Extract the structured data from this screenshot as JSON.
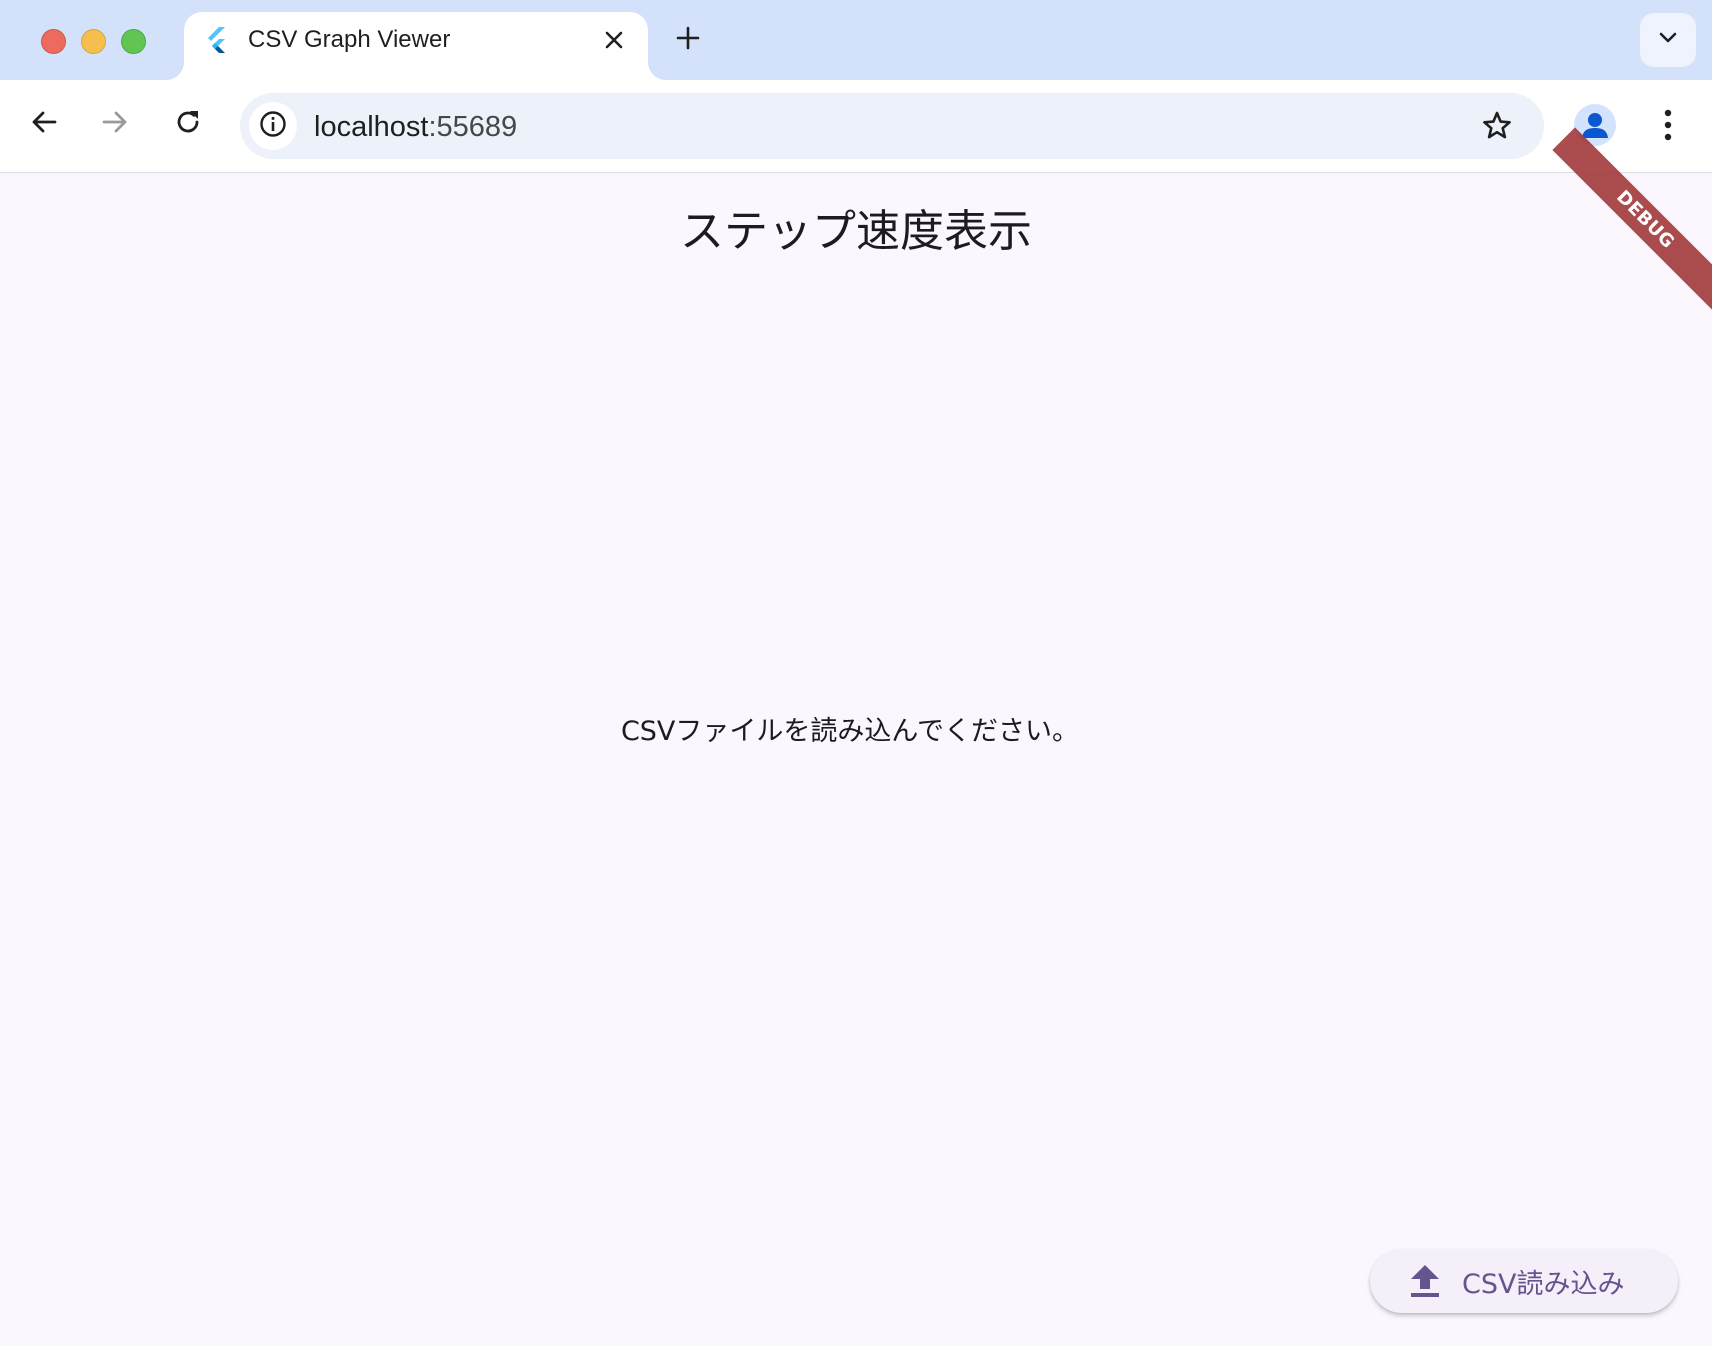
{
  "browser": {
    "tab": {
      "title": "CSV Graph Viewer",
      "favicon": "flutter-logo-icon"
    },
    "toolbar": {
      "url_host": "localhost",
      "url_port": ":55689"
    },
    "icons": {
      "close": "close-icon",
      "new_tab": "plus-icon",
      "tab_search": "chevron-down-icon",
      "back": "arrow-left-icon",
      "forward": "arrow-right-icon",
      "reload": "reload-icon",
      "site_info": "info-icon",
      "bookmark": "star-icon",
      "profile": "person-icon",
      "menu": "more-vert-icon"
    }
  },
  "app": {
    "title": "ステップ速度表示",
    "empty_message": "CSVファイルを読み込んでください。",
    "debug_label": "DEBUG",
    "fab": {
      "label": "CSV読み込み",
      "icon": "upload-icon"
    }
  },
  "colors": {
    "tabstrip": "#d4e1fa",
    "app_background": "#fcf7fe",
    "fab_background": "#f5eff9",
    "fab_accent": "#65558f",
    "debug_banner": "#a2393b",
    "profile_accent": "#0b57d0"
  }
}
